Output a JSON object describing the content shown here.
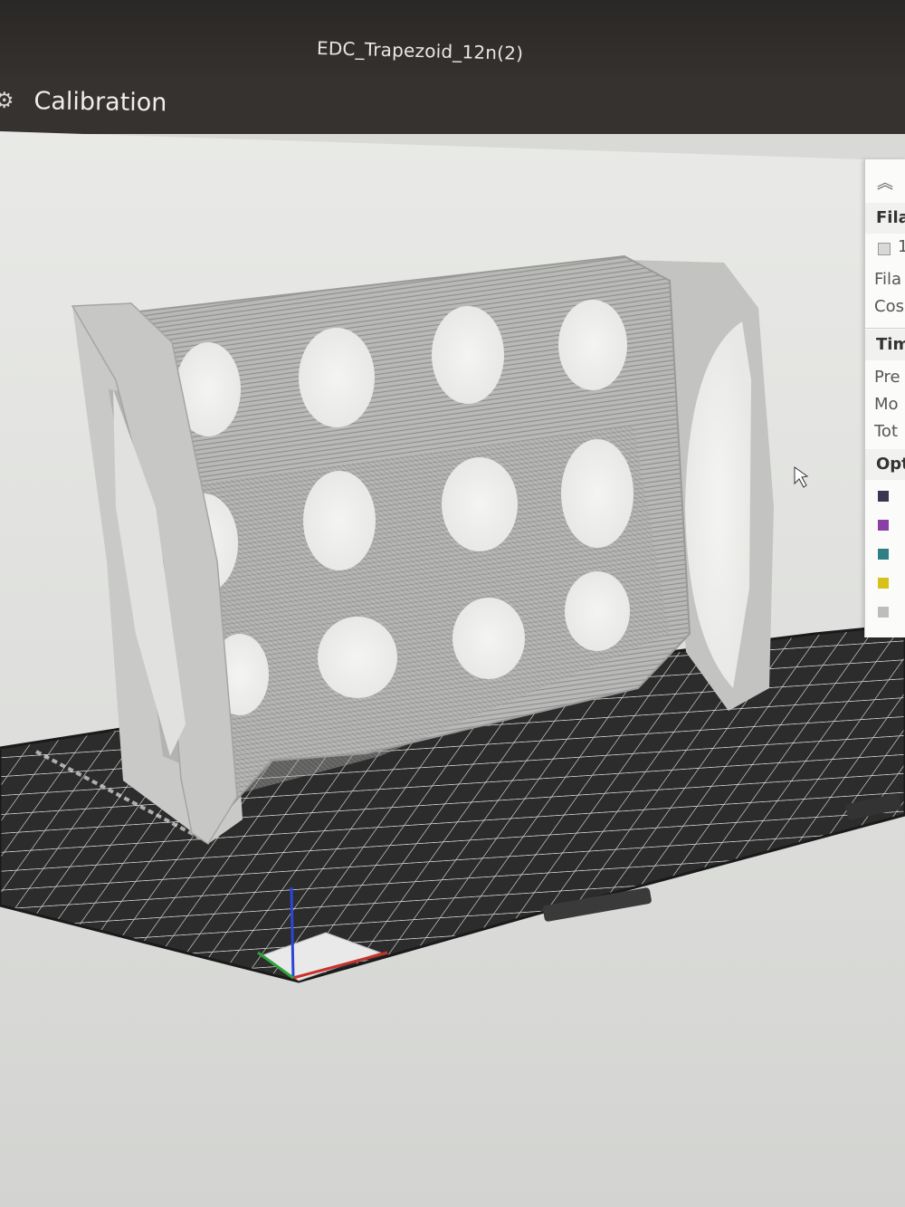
{
  "window": {
    "title": "EDC_Trapezoid_12n(2)"
  },
  "toolbar": {
    "calibration_label": "Calibration"
  },
  "side_panel": {
    "collapse_icon": "chevron-up-icon",
    "filament_header": "Fila",
    "filament_item": "1",
    "filament_label": "Fila",
    "cost_label": "Cos",
    "time_header": "Tim",
    "prepare_label": "Pre",
    "model_label": "Mo",
    "total_label": "Tot",
    "options_header": "Opt",
    "option_colors": [
      "#3b3550",
      "#8a3fa6",
      "#2f7f86",
      "#d8c21a",
      "#bdbdbd"
    ]
  }
}
